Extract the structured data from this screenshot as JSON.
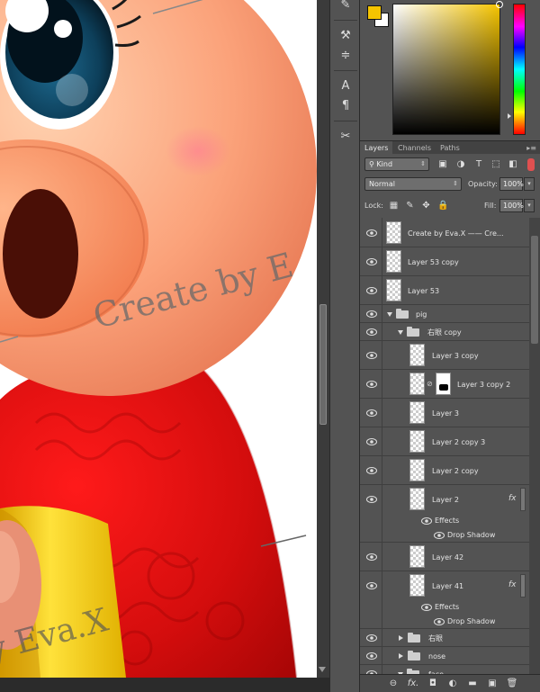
{
  "canvas": {
    "watermark_text": "Create by Eva.X",
    "watermark_text_partial_top": "Create by E",
    "watermark_text_partial_bottom": "y Eva.X"
  },
  "tools": [
    {
      "icon": "history-brush-icon",
      "glyph": "✎"
    },
    {
      "icon": "adjust-tool-icon",
      "glyph": "⚒"
    },
    {
      "icon": "sliders-icon",
      "glyph": "≑"
    },
    {
      "icon": "character-icon",
      "glyph": "A"
    },
    {
      "icon": "paragraph-icon",
      "glyph": "¶"
    },
    {
      "icon": "tool-presets-icon",
      "glyph": "✂"
    }
  ],
  "colors": {
    "foreground": "#f5c400",
    "background": "#ffffff",
    "panel_bg": "#535353",
    "row_selected": "#535353"
  },
  "tabs": {
    "layers": "Layers",
    "channels": "Channels",
    "paths": "Paths"
  },
  "filter": {
    "kind_label": "Kind"
  },
  "blend": {
    "mode": "Normal",
    "opacity_label": "Opacity:",
    "opacity_value": "100%"
  },
  "lock": {
    "label": "Lock:",
    "fill_label": "Fill:",
    "fill_value": "100%"
  },
  "layers": {
    "create_by": "Create by Eva.X     ——      Cre...",
    "layer53copy": "Layer 53 copy",
    "layer53": "Layer 53",
    "pig": "pig",
    "right_eye_copy": "右眼 copy",
    "layer3copy": "Layer 3 copy",
    "layer3copy2": "Layer 3 copy 2",
    "layer3": "Layer 3",
    "layer2copy3": "Layer 2 copy 3",
    "layer2copy": "Layer 2 copy",
    "layer2": "Layer 2",
    "effects": "Effects",
    "drop_shadow": "Drop Shadow",
    "layer42": "Layer 42",
    "layer41": "Layer 41",
    "effects2": "Effects",
    "drop_shadow2": "Drop Shadow",
    "right_eye": "右眼",
    "nose": "nose",
    "face": "face",
    "fx": "fx"
  },
  "footer": {
    "link_glyph": "⊖",
    "fx_glyph": "fx.",
    "mask_glyph": "◘",
    "adjust_glyph": "◐",
    "group_glyph": "▬",
    "new_glyph": "▣",
    "delete_glyph": "🗑"
  }
}
